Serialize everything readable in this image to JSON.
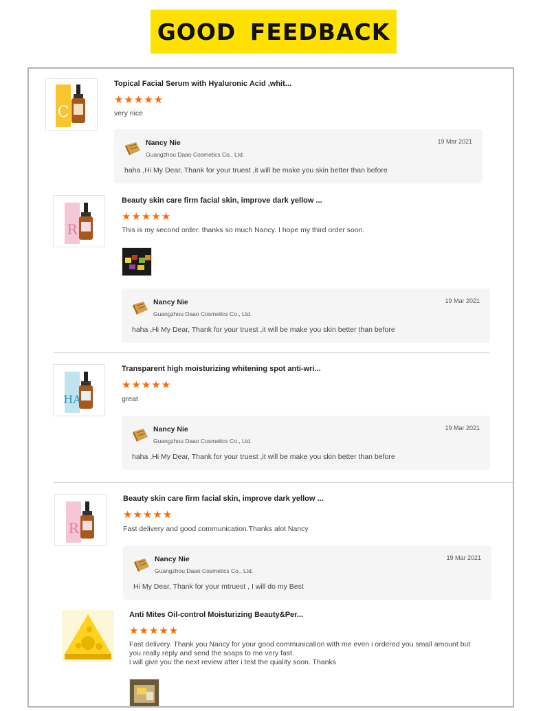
{
  "banner": {
    "title": "GOOD  FEEDBACK"
  },
  "colors": {
    "banner_bg": "#ffe100",
    "star": "#ff6a00",
    "reply_bg": "#f5f5f6"
  },
  "reviews": [
    {
      "product_title": "Topical Facial Serum with Hyaluronic Acid ,whit...",
      "rating": 5,
      "stars": "★★★★★",
      "comment": "very nice",
      "reply": {
        "name": "Nancy Nie",
        "company": "Guangzhou Daao Cosmetics Co., Ltd.",
        "date": "19 Mar 2021",
        "text": "haha ,Hi My Dear, Thank for your truest ,it will be make you skin better than before"
      }
    },
    {
      "product_title": "Beauty skin care firm facial skin, improve dark yellow ...",
      "rating": 5,
      "stars": "★★★★★",
      "comment": "This is my second order. thanks so much Nancy. I hope my third order soon.",
      "reply": {
        "name": "Nancy Nie",
        "company": "Guangzhou Daao Cosmetics Co., Ltd.",
        "date": "19 Mar 2021",
        "text": "haha ,Hi My Dear, Thank for your truest ,it will be make you skin better than before"
      }
    },
    {
      "product_title": "Transparent high moisturizing whitening spot anti-wri...",
      "rating": 5,
      "stars": "★★★★★",
      "comment": "great",
      "reply": {
        "name": "Nancy Nie",
        "company": "Guangzhou Daao Cosmetics Co., Ltd.",
        "date": "19 Mar 2021",
        "text": "haha ,Hi My Dear, Thank for your truest ,it will be make you skin better than before"
      }
    },
    {
      "product_title": "Beauty skin care firm facial skin, improve dark yellow ...",
      "rating": 5,
      "stars": "★★★★★",
      "comment": "Fast delivery and good communication.Thanks alot Nancy",
      "reply": {
        "name": "Nancy Nie",
        "company": "Guangzhou Daao Cosmetics Co., Ltd.",
        "date": "19 Mar 2021",
        "text": "Hi My Dear, Thank for your mtruest , I will do my Best"
      }
    },
    {
      "product_title": "Anti Mites Oil-control Moisturizing Beauty&Per...",
      "rating": 5,
      "stars": "★★★★★",
      "comment_lines": [
        "Fast delivery. Thank you Nancy for your good communication with me even i ordered you small amount but",
        "you really reply and send the soaps to me very fast.",
        "i will give  you the next review after i test the quality soon. Thanks"
      ]
    }
  ]
}
